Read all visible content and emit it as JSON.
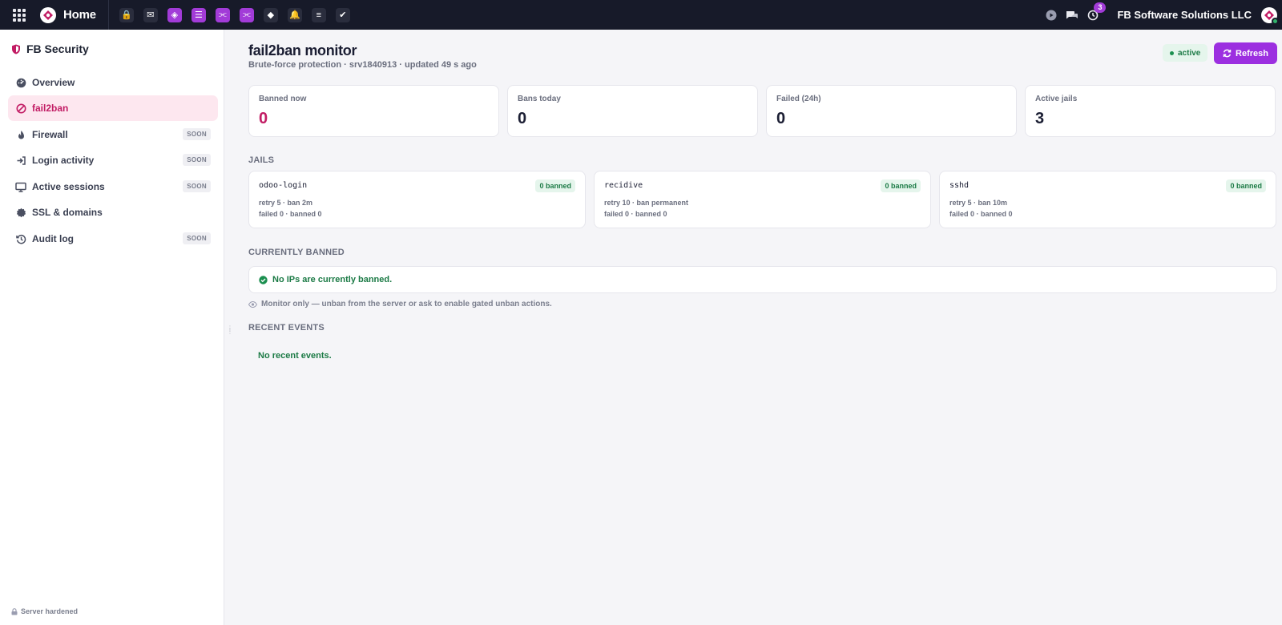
{
  "topbar": {
    "home_label": "Home",
    "company": "FB Software Solutions LLC",
    "activity_count": "3",
    "app_icons": [
      {
        "name": "lock-app-icon",
        "bg": "#2a2d3d",
        "glyph": "🔒"
      },
      {
        "name": "mail-app-icon",
        "bg": "#2a2d3d",
        "glyph": "✉"
      },
      {
        "name": "shield-app-icon",
        "bg": "#a23bd8",
        "glyph": "◈"
      },
      {
        "name": "server-app-icon",
        "bg": "#a23bd8",
        "glyph": "☰"
      },
      {
        "name": "share-app-icon",
        "bg": "#a23bd8",
        "glyph": "⫘"
      },
      {
        "name": "share-app-icon-2",
        "bg": "#a23bd8",
        "glyph": "⫘"
      },
      {
        "name": "logo-app-icon",
        "bg": "#2a2d3d",
        "glyph": "◆"
      },
      {
        "name": "bell-app-icon",
        "bg": "#2a2d3d",
        "glyph": "🔔"
      },
      {
        "name": "notes-app-icon",
        "bg": "#2a2d3d",
        "glyph": "≡"
      },
      {
        "name": "check-app-icon",
        "bg": "#2a2d3d",
        "glyph": "✔"
      }
    ]
  },
  "sidebar": {
    "brand": "FB Security",
    "items": [
      {
        "label": "Overview",
        "soon": ""
      },
      {
        "label": "fail2ban",
        "soon": ""
      },
      {
        "label": "Firewall",
        "soon": "SOON"
      },
      {
        "label": "Login activity",
        "soon": "SOON"
      },
      {
        "label": "Active sessions",
        "soon": "SOON"
      },
      {
        "label": "SSL & domains",
        "soon": ""
      },
      {
        "label": "Audit log",
        "soon": "SOON"
      }
    ],
    "footer": "Server hardened"
  },
  "header": {
    "title": "fail2ban monitor",
    "subtitle": "Brute-force protection · srv1840913 · updated 49 s ago",
    "status": "active",
    "refresh_label": "Refresh"
  },
  "stats": [
    {
      "label": "Banned now",
      "value": "0"
    },
    {
      "label": "Bans today",
      "value": "0"
    },
    {
      "label": "Failed (24h)",
      "value": "0"
    },
    {
      "label": "Active jails",
      "value": "3"
    }
  ],
  "jails_title": "JAILS",
  "jails": [
    {
      "name": "odoo-login",
      "badge": "0 banned",
      "config": "retry 5 · ban 2m",
      "counts": "failed 0 · banned 0"
    },
    {
      "name": "recidive",
      "badge": "0 banned",
      "config": "retry 10 · ban permanent",
      "counts": "failed 0 · banned 0"
    },
    {
      "name": "sshd",
      "badge": "0 banned",
      "config": "retry 5 · ban 10m",
      "counts": "failed 0 · banned 0"
    }
  ],
  "banned": {
    "title": "CURRENTLY BANNED",
    "message": "No IPs are currently banned.",
    "note": "Monitor only — unban from the server or ask to enable gated unban actions."
  },
  "events": {
    "title": "RECENT EVENTS",
    "message": "No recent events."
  },
  "colors": {
    "accent": "#9c2fe0",
    "brand": "#c21c64",
    "success": "#1b7a45",
    "topbar": "#171a29"
  }
}
